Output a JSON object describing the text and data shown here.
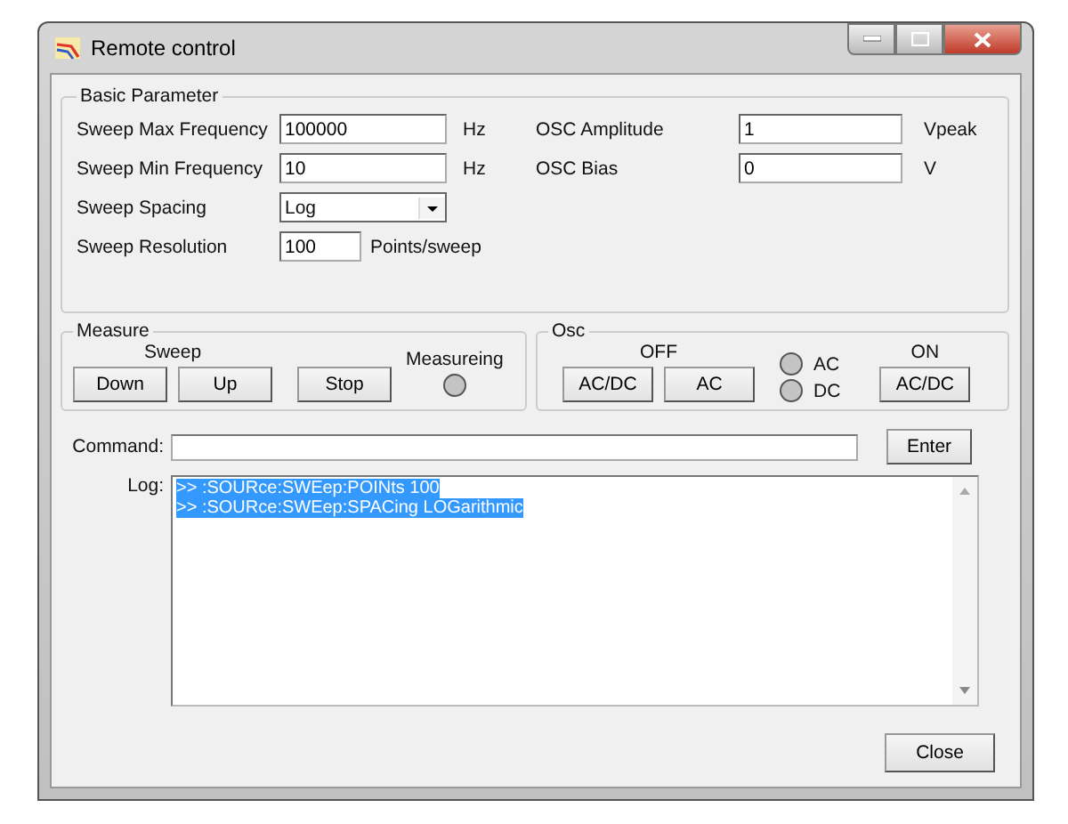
{
  "window": {
    "title": "Remote control"
  },
  "basic_parameter": {
    "title": "Basic Parameter",
    "left": [
      {
        "kind": "text",
        "label": "Sweep Max Frequency",
        "value": "100000",
        "unit": "Hz"
      },
      {
        "kind": "text",
        "label": "Sweep Min Frequency",
        "value": "10",
        "unit": "Hz"
      },
      {
        "kind": "dropdown",
        "label": "Sweep Spacing",
        "value": "Log"
      },
      {
        "kind": "short",
        "label": "Sweep Resolution",
        "value": "100",
        "unit": "Points/sweep"
      }
    ],
    "right": [
      {
        "label": "OSC Amplitude",
        "value": "1",
        "unit": "Vpeak"
      },
      {
        "label": "OSC Bias",
        "value": "0",
        "unit": "V"
      }
    ]
  },
  "measure": {
    "title": "Measure",
    "sweep_label": "Sweep",
    "buttons": [
      "Down",
      "Up",
      "Stop"
    ],
    "indicator": {
      "label": "Measureing",
      "on": false
    }
  },
  "osc": {
    "title": "Osc",
    "off_label": "OFF",
    "off_buttons": [
      "AC/DC",
      "AC"
    ],
    "indicators": [
      {
        "label": "AC",
        "on": false
      },
      {
        "label": "DC",
        "on": false
      }
    ],
    "on_label": "ON",
    "on_button": "AC/DC"
  },
  "command": {
    "label": "Command:",
    "button": "Enter"
  },
  "log": {
    "label": "Log:",
    "lines": [
      {
        "text": ">> :SOURce:SWEep:POINts 100",
        "selected": true
      },
      {
        "text": ">> :SOURce:SWEep:SPACing LOGarithmic",
        "selected": true
      }
    ]
  },
  "close_button": "Close"
}
